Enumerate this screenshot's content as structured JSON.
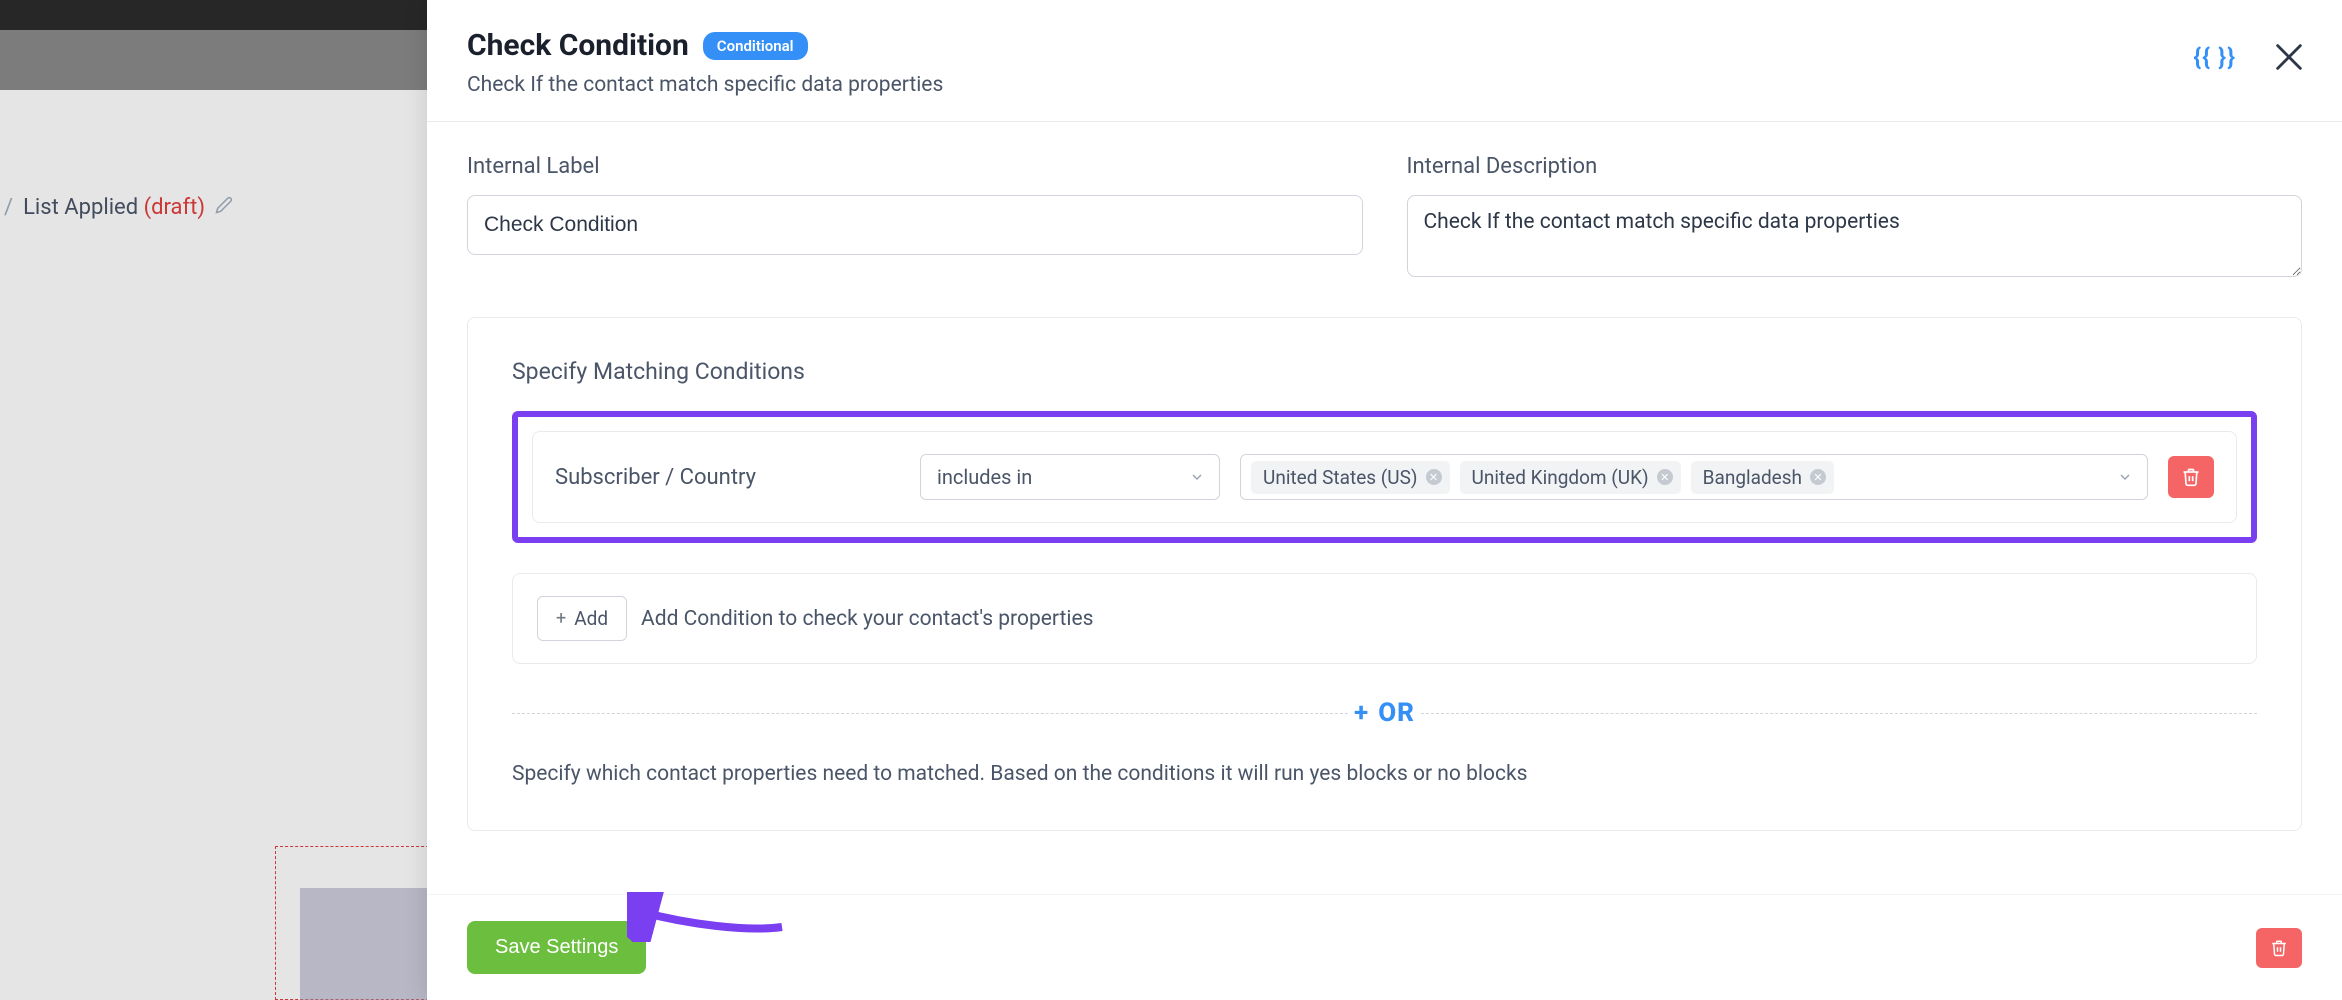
{
  "breadcrumb": {
    "name": "List Applied",
    "status": "(draft)"
  },
  "modal": {
    "title": "Check Condition",
    "badge": "Conditional",
    "subtitle": "Check If the contact match specific data properties",
    "smart_codes_glyph": "{{ }}"
  },
  "fields": {
    "internal_label": {
      "label": "Internal Label",
      "value": "Check Condition"
    },
    "internal_description": {
      "label": "Internal Description",
      "value": "Check If the contact match specific data properties"
    }
  },
  "conditions": {
    "title": "Specify Matching Conditions",
    "row": {
      "field": "Subscriber / Country",
      "operator": "includes in",
      "tags": [
        "United States (US)",
        "United Kingdom (UK)",
        "Bangladesh"
      ]
    },
    "add_button": "Add",
    "add_desc": "Add Condition to check your contact's properties",
    "or_label": "OR",
    "helper": "Specify which contact properties need to matched. Based on the conditions it will run yes blocks or no blocks"
  },
  "footer": {
    "save_label": "Save Settings"
  }
}
